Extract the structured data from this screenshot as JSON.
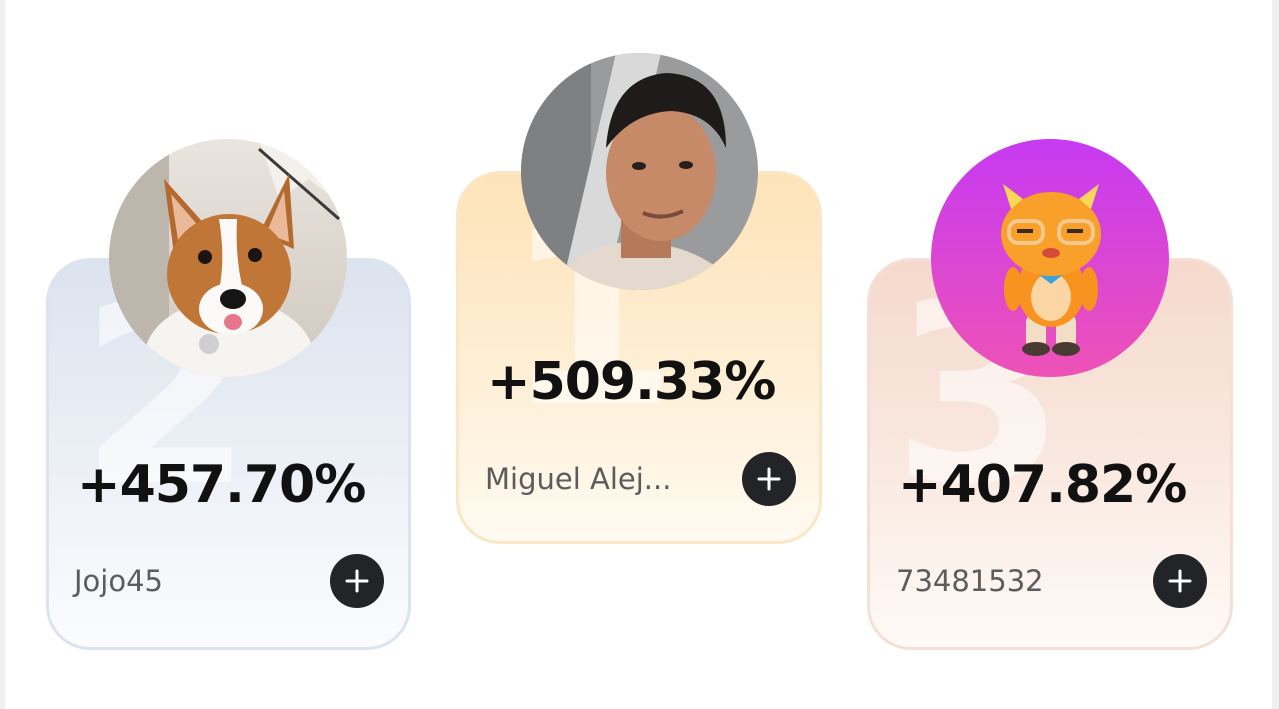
{
  "leaderboard": {
    "entries": [
      {
        "rank": "2",
        "gain": "+457.70%",
        "username": "Jojo45",
        "avatar_icon": "corgi-dog-photo"
      },
      {
        "rank": "1",
        "gain": "+509.33%",
        "username": "Miguel Alej...",
        "avatar_icon": "man-portrait-photo"
      },
      {
        "rank": "3",
        "gain": "+407.82%",
        "username": "73481532",
        "avatar_icon": "orange-cartoon-mascot"
      }
    ],
    "add_icon": "plus-icon"
  },
  "colors": {
    "card_silver": "#dce3ee",
    "card_gold": "#fde3b8",
    "card_bronze": "#f5d9cc",
    "button_dark": "#232427"
  }
}
